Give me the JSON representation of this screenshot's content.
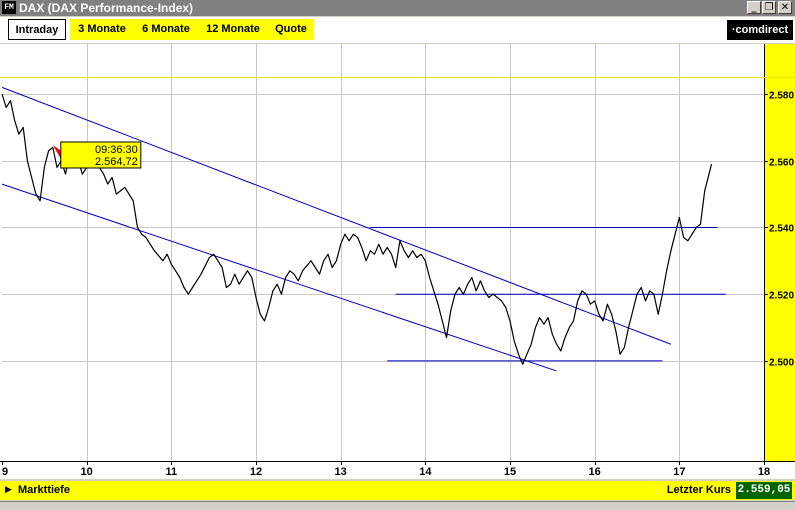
{
  "window": {
    "app_icon": "FM",
    "title": "DAX (DAX Performance-Index)",
    "minimize_symbol": "_",
    "restore_symbol": "❐",
    "close_symbol": "✕"
  },
  "tabs": [
    {
      "label": "Intraday",
      "active": true
    },
    {
      "label": "3 Monate",
      "active": false
    },
    {
      "label": "6 Monate",
      "active": false
    },
    {
      "label": "12 Monate",
      "active": false
    },
    {
      "label": "Quote",
      "active": false
    }
  ],
  "logo": {
    "text": "·comdirect"
  },
  "colors": {
    "accent_yellow": "#ffff00",
    "trendline_blue": "#0000c0",
    "price_line": "#000000",
    "reference_line": "#e8e800",
    "last_value_bg": "#006400"
  },
  "chart_data": {
    "type": "line",
    "x_ticks": [
      "9",
      "10",
      "11",
      "12",
      "13",
      "14",
      "15",
      "16",
      "17",
      "18"
    ],
    "y_ticks": [
      "2.500",
      "2.520",
      "2.540",
      "2.560",
      "2.580"
    ],
    "xlim": [
      9,
      18
    ],
    "ylim": [
      2470,
      2595
    ],
    "grid": true,
    "reference_level": 2585,
    "tooltip": {
      "time": "09:36:30",
      "value": "2.564,72",
      "x": 9.6,
      "y": 2564.72
    },
    "series": [
      {
        "points": [
          [
            9.0,
            2580
          ],
          [
            9.05,
            2576
          ],
          [
            9.1,
            2578
          ],
          [
            9.15,
            2572
          ],
          [
            9.2,
            2568
          ],
          [
            9.25,
            2570
          ],
          [
            9.3,
            2560
          ],
          [
            9.35,
            2555
          ],
          [
            9.4,
            2550
          ],
          [
            9.45,
            2548
          ],
          [
            9.5,
            2558
          ],
          [
            9.55,
            2563
          ],
          [
            9.6,
            2564
          ],
          [
            9.65,
            2558
          ],
          [
            9.7,
            2560
          ],
          [
            9.75,
            2556
          ],
          [
            9.8,
            2562
          ],
          [
            9.85,
            2558
          ],
          [
            9.9,
            2560
          ],
          [
            9.95,
            2556
          ],
          [
            10.0,
            2558
          ],
          [
            10.05,
            2560
          ],
          [
            10.1,
            2563
          ],
          [
            10.15,
            2558
          ],
          [
            10.2,
            2556
          ],
          [
            10.25,
            2553
          ],
          [
            10.3,
            2555
          ],
          [
            10.35,
            2550
          ],
          [
            10.45,
            2552
          ],
          [
            10.55,
            2548
          ],
          [
            10.6,
            2540
          ],
          [
            10.65,
            2538
          ],
          [
            10.7,
            2537
          ],
          [
            10.75,
            2535
          ],
          [
            10.8,
            2533
          ],
          [
            10.9,
            2530
          ],
          [
            10.95,
            2532
          ],
          [
            11.0,
            2529
          ],
          [
            11.05,
            2527
          ],
          [
            11.1,
            2525
          ],
          [
            11.15,
            2522
          ],
          [
            11.2,
            2520
          ],
          [
            11.25,
            2522
          ],
          [
            11.3,
            2524
          ],
          [
            11.35,
            2526
          ],
          [
            11.45,
            2531
          ],
          [
            11.5,
            2532
          ],
          [
            11.55,
            2530
          ],
          [
            11.6,
            2528
          ],
          [
            11.65,
            2522
          ],
          [
            11.7,
            2523
          ],
          [
            11.75,
            2526
          ],
          [
            11.8,
            2523
          ],
          [
            11.85,
            2525
          ],
          [
            11.9,
            2527
          ],
          [
            11.95,
            2525
          ],
          [
            12.0,
            2519
          ],
          [
            12.05,
            2514
          ],
          [
            12.1,
            2512
          ],
          [
            12.15,
            2516
          ],
          [
            12.2,
            2521
          ],
          [
            12.25,
            2523
          ],
          [
            12.3,
            2520
          ],
          [
            12.35,
            2525
          ],
          [
            12.4,
            2527
          ],
          [
            12.45,
            2526
          ],
          [
            12.5,
            2524
          ],
          [
            12.55,
            2527
          ],
          [
            12.65,
            2530
          ],
          [
            12.7,
            2528
          ],
          [
            12.75,
            2526
          ],
          [
            12.8,
            2530
          ],
          [
            12.85,
            2532
          ],
          [
            12.9,
            2528
          ],
          [
            12.95,
            2530
          ],
          [
            13.0,
            2535
          ],
          [
            13.05,
            2538
          ],
          [
            13.1,
            2536
          ],
          [
            13.15,
            2538
          ],
          [
            13.2,
            2537
          ],
          [
            13.25,
            2534
          ],
          [
            13.3,
            2530
          ],
          [
            13.35,
            2533
          ],
          [
            13.4,
            2532
          ],
          [
            13.45,
            2535
          ],
          [
            13.5,
            2532
          ],
          [
            13.55,
            2534
          ],
          [
            13.6,
            2532
          ],
          [
            13.65,
            2528
          ],
          [
            13.7,
            2536
          ],
          [
            13.75,
            2533
          ],
          [
            13.8,
            2531
          ],
          [
            13.85,
            2533
          ],
          [
            13.9,
            2531
          ],
          [
            13.95,
            2532
          ],
          [
            14.0,
            2530
          ],
          [
            14.05,
            2525
          ],
          [
            14.1,
            2521
          ],
          [
            14.15,
            2517
          ],
          [
            14.2,
            2512
          ],
          [
            14.25,
            2507
          ],
          [
            14.3,
            2515
          ],
          [
            14.35,
            2520
          ],
          [
            14.4,
            2522
          ],
          [
            14.45,
            2520
          ],
          [
            14.5,
            2523
          ],
          [
            14.55,
            2525
          ],
          [
            14.6,
            2521
          ],
          [
            14.65,
            2524
          ],
          [
            14.7,
            2521
          ],
          [
            14.75,
            2519
          ],
          [
            14.8,
            2520
          ],
          [
            14.85,
            2519
          ],
          [
            14.9,
            2518
          ],
          [
            14.95,
            2516
          ],
          [
            15.0,
            2512
          ],
          [
            15.05,
            2506
          ],
          [
            15.1,
            2502
          ],
          [
            15.15,
            2499
          ],
          [
            15.2,
            2502
          ],
          [
            15.25,
            2505
          ],
          [
            15.3,
            2510
          ],
          [
            15.35,
            2513
          ],
          [
            15.4,
            2511
          ],
          [
            15.45,
            2513
          ],
          [
            15.5,
            2508
          ],
          [
            15.55,
            2505
          ],
          [
            15.6,
            2503
          ],
          [
            15.65,
            2507
          ],
          [
            15.7,
            2510
          ],
          [
            15.75,
            2512
          ],
          [
            15.8,
            2518
          ],
          [
            15.85,
            2521
          ],
          [
            15.9,
            2520
          ],
          [
            15.95,
            2517
          ],
          [
            16.0,
            2518
          ],
          [
            16.05,
            2514
          ],
          [
            16.1,
            2512
          ],
          [
            16.15,
            2517
          ],
          [
            16.2,
            2514
          ],
          [
            16.25,
            2509
          ],
          [
            16.3,
            2502
          ],
          [
            16.35,
            2504
          ],
          [
            16.4,
            2510
          ],
          [
            16.45,
            2515
          ],
          [
            16.5,
            2520
          ],
          [
            16.55,
            2522
          ],
          [
            16.6,
            2518
          ],
          [
            16.65,
            2521
          ],
          [
            16.7,
            2520
          ],
          [
            16.75,
            2514
          ],
          [
            16.8,
            2520
          ],
          [
            16.85,
            2527
          ],
          [
            16.9,
            2533
          ],
          [
            16.95,
            2538
          ],
          [
            17.0,
            2543
          ],
          [
            17.05,
            2537
          ],
          [
            17.1,
            2536
          ],
          [
            17.15,
            2538
          ],
          [
            17.2,
            2540
          ],
          [
            17.25,
            2541
          ],
          [
            17.3,
            2551
          ],
          [
            17.35,
            2556
          ],
          [
            17.38,
            2559
          ]
        ]
      }
    ],
    "trendlines": [
      {
        "from": [
          9.0,
          2582
        ],
        "to": [
          16.9,
          2505
        ]
      },
      {
        "from": [
          9.0,
          2553
        ],
        "to": [
          15.55,
          2497
        ]
      },
      {
        "from": [
          13.35,
          2540
        ],
        "to": [
          17.45,
          2540
        ]
      },
      {
        "from": [
          13.65,
          2520
        ],
        "to": [
          17.55,
          2520
        ]
      },
      {
        "from": [
          13.55,
          2500
        ],
        "to": [
          16.8,
          2500
        ]
      }
    ]
  },
  "bottom": {
    "arrow_symbol": "▶",
    "markttiefe_label": "Markttiefe",
    "letzter_kurs_label": "Letzter Kurs",
    "letzter_kurs_value": "2.559,05"
  }
}
